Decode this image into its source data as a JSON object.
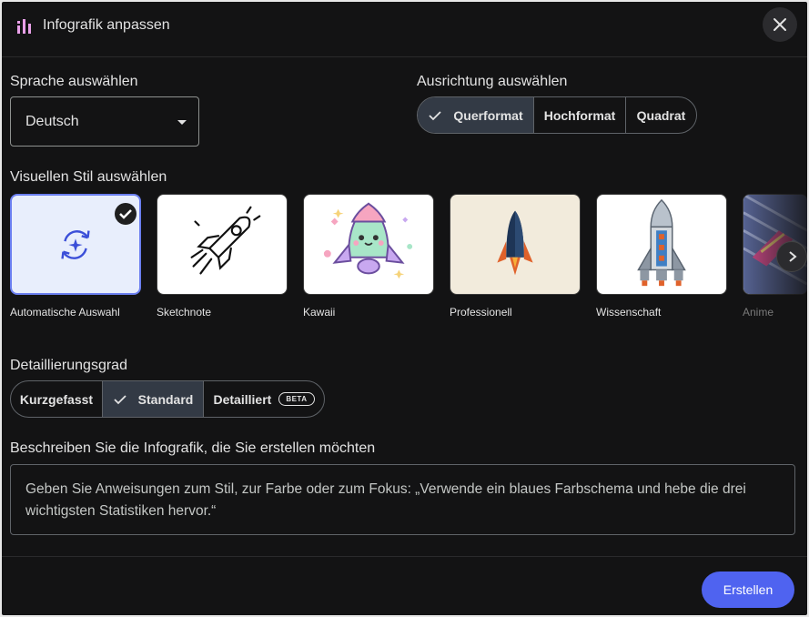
{
  "header": {
    "title": "Infografik anpassen",
    "icon": "chart-bars-icon",
    "close_icon": "close-icon"
  },
  "language": {
    "label": "Sprache auswählen",
    "selected": "Deutsch"
  },
  "orientation": {
    "label": "Ausrichtung auswählen",
    "options": [
      "Querformat",
      "Hochformat",
      "Quadrat"
    ],
    "selected": "Querformat"
  },
  "style": {
    "label": "Visuellen Stil auswählen",
    "cards": [
      {
        "label": "Automatische Auswahl",
        "icon": "auto-refresh-sparkle-icon",
        "selected": true
      },
      {
        "label": "Sketchnote",
        "icon": "sketch-rocket-icon"
      },
      {
        "label": "Kawaii",
        "icon": "kawaii-rocket-icon"
      },
      {
        "label": "Professionell",
        "icon": "professional-rocket-icon"
      },
      {
        "label": "Wissenschaft",
        "icon": "science-rocket-icon"
      },
      {
        "label": "Anime",
        "icon": "anime-rocket-icon"
      }
    ]
  },
  "detail": {
    "label": "Detaillierungsgrad",
    "options": [
      "Kurzgefasst",
      "Standard",
      "Detailliert"
    ],
    "selected": "Standard",
    "beta": "BETA"
  },
  "description": {
    "label": "Beschreiben Sie die Infografik, die Sie erstellen möchten",
    "placeholder": "Geben Sie Anweisungen zum Stil, zur Farbe oder zum Fokus: „Verwende ein blaues Farbschema und hebe die drei wichtigsten Statistiken hervor.“"
  },
  "actions": {
    "create": "Erstellen"
  },
  "colors": {
    "background": "#131314",
    "accent": "#4f63f0",
    "selected_segment": "#333a45"
  }
}
